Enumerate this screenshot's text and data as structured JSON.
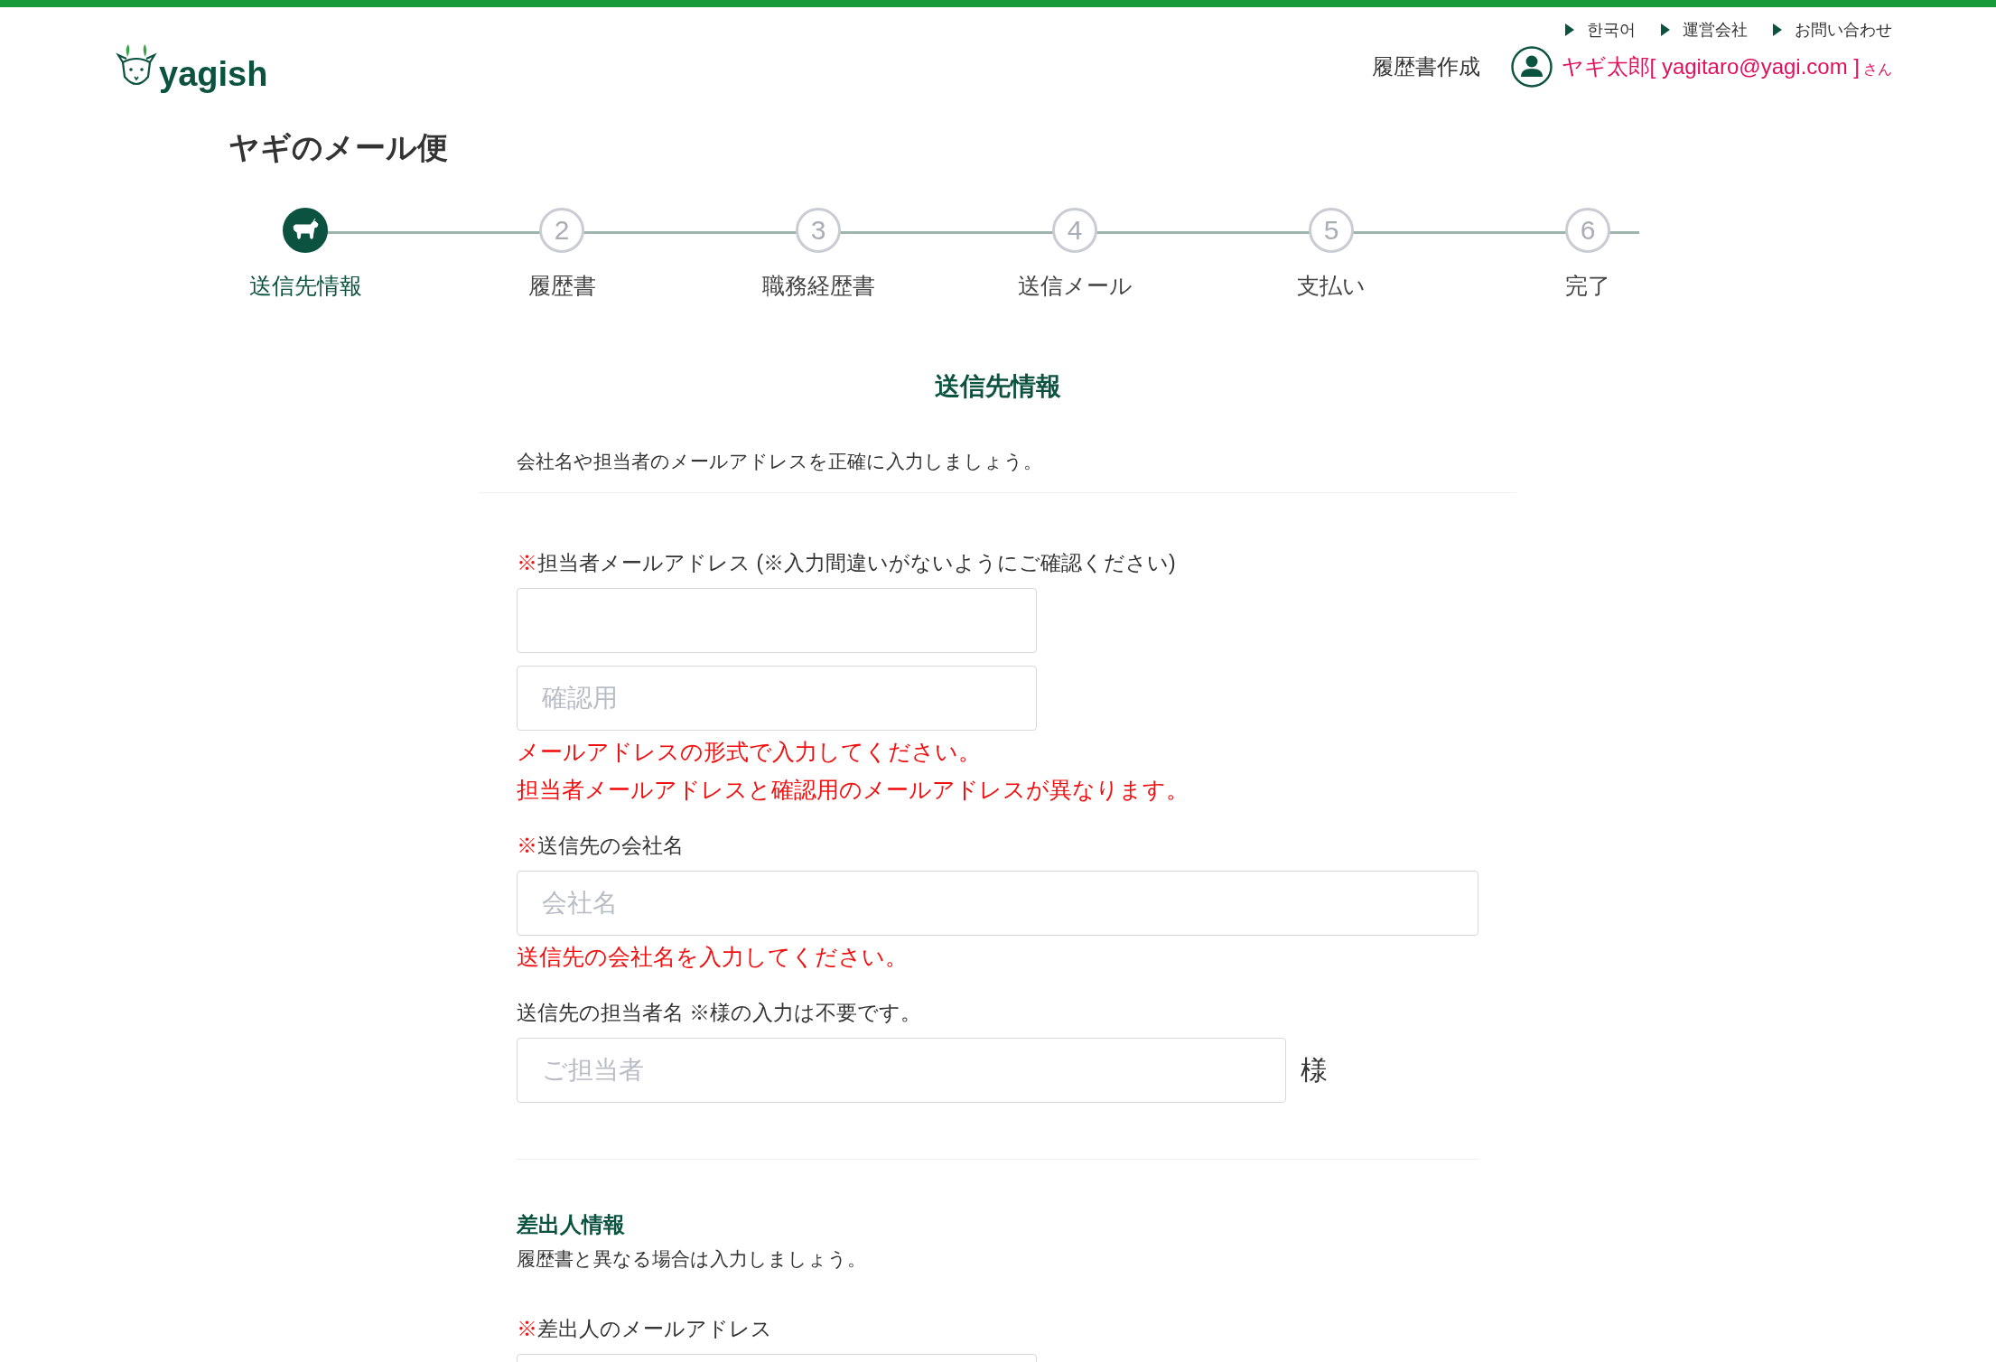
{
  "top_links": [
    {
      "label": "한국어"
    },
    {
      "label": "運営会社"
    },
    {
      "label": "お問い合わせ"
    }
  ],
  "logo": {
    "text": "yagish"
  },
  "nav": {
    "label": "履歴書作成"
  },
  "user": {
    "name": "ヤギ太郎[ yagitaro@yagi.com ]",
    "suffix": "さん"
  },
  "title": "ヤギのメール便",
  "steps": [
    {
      "label": "送信先情報",
      "selected": true
    },
    {
      "number": "2",
      "label": "履歴書",
      "selected": false
    },
    {
      "number": "3",
      "label": "職務経歴書",
      "selected": false
    },
    {
      "number": "4",
      "label": "送信メール",
      "selected": false
    },
    {
      "number": "5",
      "label": "支払い",
      "selected": false
    },
    {
      "number": "6",
      "label": "完了",
      "selected": false
    }
  ],
  "sections": [
    {
      "kind": "main",
      "heading": "送信先情報",
      "intro": "会社名や担当者のメールアドレスを正確に入力しましょう。",
      "fields": [
        {
          "marker": "※",
          "label": "担当者メールアドレス (※入力間違いがないようにご確認ください)",
          "inputs": [
            {
              "kind": "medium"
            },
            {
              "kind": "medium",
              "placeholder": "確認用"
            }
          ],
          "errors": [
            "メールアドレスの形式で入力してください。",
            "担当者メールアドレスと確認用のメールアドレスが異なります。"
          ]
        },
        {
          "marker": "※",
          "label": "送信先の会社名",
          "inputs": [
            {
              "kind": "wide",
              "placeholder": "会社名"
            }
          ],
          "errors": [
            "送信先の会社名を入力してください。"
          ]
        },
        {
          "label": "送信先の担当者名 ※様の入力は不要です。",
          "inputs": [
            {
              "kind": "long",
              "placeholder": "ご担当者",
              "suffix": "様"
            }
          ]
        }
      ]
    },
    {
      "kind": "sub",
      "heading": "差出人情報",
      "intro": "履歴書と異なる場合は入力しましょう。",
      "fields": [
        {
          "marker": "※",
          "label": "差出人のメールアドレス",
          "inputs": [
            {
              "kind": "medium"
            }
          ]
        }
      ]
    }
  ]
}
